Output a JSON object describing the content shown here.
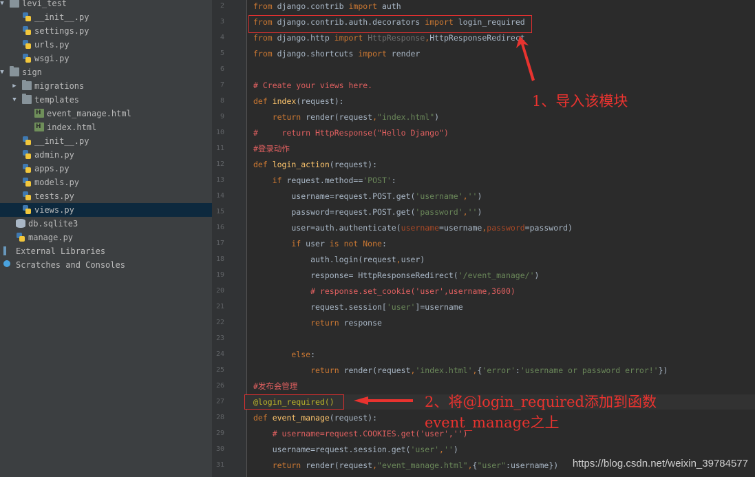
{
  "project_tree": [
    {
      "label": "levi_test",
      "type": "folder",
      "depth": 0,
      "expanded": true
    },
    {
      "label": "__init__.py",
      "type": "py",
      "depth": 1
    },
    {
      "label": "settings.py",
      "type": "py",
      "depth": 1
    },
    {
      "label": "urls.py",
      "type": "py",
      "depth": 1
    },
    {
      "label": "wsgi.py",
      "type": "py",
      "depth": 1
    },
    {
      "label": "sign",
      "type": "folder",
      "depth": 0,
      "expanded": true
    },
    {
      "label": "migrations",
      "type": "folder",
      "depth": 1,
      "expanded": false
    },
    {
      "label": "templates",
      "type": "folder",
      "depth": 1,
      "expanded": true
    },
    {
      "label": "event_manage.html",
      "type": "html",
      "depth": 2
    },
    {
      "label": "index.html",
      "type": "html",
      "depth": 2
    },
    {
      "label": "__init__.py",
      "type": "py",
      "depth": 1
    },
    {
      "label": "admin.py",
      "type": "py",
      "depth": 1
    },
    {
      "label": "apps.py",
      "type": "py",
      "depth": 1
    },
    {
      "label": "models.py",
      "type": "py",
      "depth": 1
    },
    {
      "label": "tests.py",
      "type": "py",
      "depth": 1
    },
    {
      "label": "views.py",
      "type": "py",
      "depth": 1,
      "selected": true
    },
    {
      "label": "db.sqlite3",
      "type": "db",
      "depth": 0.5
    },
    {
      "label": "manage.py",
      "type": "py",
      "depth": 0.5
    },
    {
      "label": "External Libraries",
      "type": "lib",
      "depth": -0.5
    },
    {
      "label": "Scratches and Consoles",
      "type": "scratch",
      "depth": -0.5
    }
  ],
  "editor": {
    "line_numbers": [
      "2",
      "3",
      "4",
      "5",
      "6",
      "7",
      "8",
      "9",
      "10",
      "11",
      "12",
      "13",
      "14",
      "15",
      "16",
      "17",
      "18",
      "19",
      "20",
      "21",
      "22",
      "23",
      "24",
      "25",
      "26",
      "27",
      "28",
      "29",
      "30",
      "31"
    ],
    "lines": [
      [
        {
          "t": "from ",
          "c": "kw"
        },
        {
          "t": "django.contrib ",
          "c": ""
        },
        {
          "t": "import ",
          "c": "kw"
        },
        {
          "t": "auth",
          "c": ""
        }
      ],
      [
        {
          "t": "from ",
          "c": "kw"
        },
        {
          "t": "django.contrib.auth.decorators ",
          "c": ""
        },
        {
          "t": "import ",
          "c": "kw"
        },
        {
          "t": "login_required",
          "c": ""
        }
      ],
      [
        {
          "t": "from ",
          "c": "kw"
        },
        {
          "t": "django.http ",
          "c": ""
        },
        {
          "t": "import ",
          "c": "kw"
        },
        {
          "t": "HttpResponse",
          "c": "gray"
        },
        {
          "t": ",",
          "c": "kw"
        },
        {
          "t": "HttpResponseRedirect",
          "c": ""
        }
      ],
      [
        {
          "t": "from ",
          "c": "kw"
        },
        {
          "t": "django.shortcuts ",
          "c": ""
        },
        {
          "t": "import ",
          "c": "kw"
        },
        {
          "t": "render",
          "c": ""
        }
      ],
      [],
      [
        {
          "t": "# Create your views here.",
          "c": "cm-red"
        }
      ],
      [
        {
          "t": "def ",
          "c": "kw"
        },
        {
          "t": "index",
          "c": "fn"
        },
        {
          "t": "(request):",
          "c": ""
        }
      ],
      [
        {
          "t": "    return ",
          "c": "kw"
        },
        {
          "t": "render(request",
          "c": ""
        },
        {
          "t": ",",
          "c": "kw"
        },
        {
          "t": "\"index.html\"",
          "c": "str"
        },
        {
          "t": ")",
          "c": ""
        }
      ],
      [
        {
          "t": "#     return HttpResponse(\"Hello Django\")",
          "c": "cm-red"
        }
      ],
      [
        {
          "t": "#登录动作",
          "c": "cm-red"
        }
      ],
      [
        {
          "t": "def ",
          "c": "kw"
        },
        {
          "t": "login_action",
          "c": "fn"
        },
        {
          "t": "(request):",
          "c": ""
        }
      ],
      [
        {
          "t": "    if ",
          "c": "kw"
        },
        {
          "t": "request.method==",
          "c": ""
        },
        {
          "t": "'POST'",
          "c": "str"
        },
        {
          "t": ":",
          "c": ""
        }
      ],
      [
        {
          "t": "        username=request.POST.get(",
          "c": ""
        },
        {
          "t": "'username'",
          "c": "str"
        },
        {
          "t": ",",
          "c": "kw"
        },
        {
          "t": "''",
          "c": "str"
        },
        {
          "t": ")",
          "c": ""
        }
      ],
      [
        {
          "t": "        password=request.POST.get(",
          "c": ""
        },
        {
          "t": "'password'",
          "c": "str"
        },
        {
          "t": ",",
          "c": "kw"
        },
        {
          "t": "''",
          "c": "str"
        },
        {
          "t": ")",
          "c": ""
        }
      ],
      [
        {
          "t": "        user=auth.authenticate(",
          "c": ""
        },
        {
          "t": "username",
          "c": "param"
        },
        {
          "t": "=username",
          "c": ""
        },
        {
          "t": ",",
          "c": "kw"
        },
        {
          "t": "password",
          "c": "param"
        },
        {
          "t": "=password)",
          "c": ""
        }
      ],
      [
        {
          "t": "        if ",
          "c": "kw"
        },
        {
          "t": "user ",
          "c": ""
        },
        {
          "t": "is not None",
          "c": "kw"
        },
        {
          "t": ":",
          "c": ""
        }
      ],
      [
        {
          "t": "            auth.login(request",
          "c": ""
        },
        {
          "t": ",",
          "c": "kw"
        },
        {
          "t": "user)",
          "c": ""
        }
      ],
      [
        {
          "t": "            response= HttpResponseRedirect(",
          "c": ""
        },
        {
          "t": "'/event_manage/'",
          "c": "str"
        },
        {
          "t": ")",
          "c": ""
        }
      ],
      [
        {
          "t": "            # response.set_cookie('user',username,3600)",
          "c": "cm-red"
        }
      ],
      [
        {
          "t": "            request.session[",
          "c": ""
        },
        {
          "t": "'user'",
          "c": "str"
        },
        {
          "t": "]=username",
          "c": ""
        }
      ],
      [
        {
          "t": "            return ",
          "c": "kw"
        },
        {
          "t": "response",
          "c": ""
        }
      ],
      [],
      [
        {
          "t": "        else",
          "c": "kw"
        },
        {
          "t": ":",
          "c": ""
        }
      ],
      [
        {
          "t": "            return ",
          "c": "kw"
        },
        {
          "t": "render(request",
          "c": ""
        },
        {
          "t": ",",
          "c": "kw"
        },
        {
          "t": "'index.html'",
          "c": "str"
        },
        {
          "t": ",",
          "c": "kw"
        },
        {
          "t": "{",
          "c": ""
        },
        {
          "t": "'error'",
          "c": "str"
        },
        {
          "t": ":",
          "c": ""
        },
        {
          "t": "'username or password error!'",
          "c": "str"
        },
        {
          "t": "})",
          "c": ""
        }
      ],
      [
        {
          "t": "#发布会管理",
          "c": "cm-red"
        }
      ],
      [
        {
          "t": "@login_required()",
          "c": "dec"
        }
      ],
      [
        {
          "t": "def ",
          "c": "kw"
        },
        {
          "t": "event_manage",
          "c": "fn"
        },
        {
          "t": "(request):",
          "c": ""
        }
      ],
      [
        {
          "t": "    # username=request.COOKIES.get('user','')",
          "c": "cm-red"
        }
      ],
      [
        {
          "t": "    username=request.session.get(",
          "c": ""
        },
        {
          "t": "'user'",
          "c": "str"
        },
        {
          "t": ",",
          "c": "kw"
        },
        {
          "t": "''",
          "c": "str"
        },
        {
          "t": ")",
          "c": ""
        }
      ],
      [
        {
          "t": "    return ",
          "c": "kw"
        },
        {
          "t": "render(request",
          "c": ""
        },
        {
          "t": ",",
          "c": "kw"
        },
        {
          "t": "\"event_manage.html\"",
          "c": "str"
        },
        {
          "t": ",",
          "c": "kw"
        },
        {
          "t": "{",
          "c": ""
        },
        {
          "t": "\"user\"",
          "c": "str"
        },
        {
          "t": ":username})",
          "c": ""
        }
      ]
    ]
  },
  "annotations": {
    "note1": "1、导入该模块",
    "note2_line1": "2、将@login_required添加到函数",
    "note2_line2": "event_manage之上"
  },
  "watermark": "https://blog.csdn.net/weixin_39784577",
  "colors": {
    "annotation": "#e8332f",
    "keyword": "#cc7832",
    "string": "#6a8759",
    "function": "#ffc66d"
  }
}
